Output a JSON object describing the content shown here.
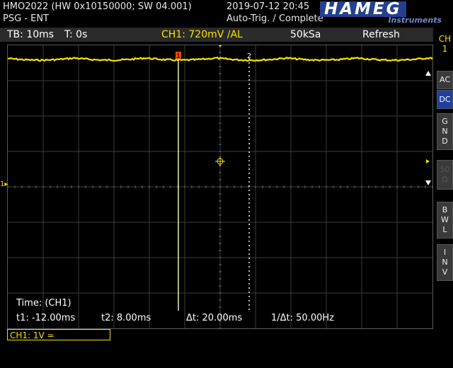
{
  "header": {
    "model": "HMO2022 (HW 0x10150000; SW 04.001)",
    "mode": "PSG - ENT",
    "datetime": "2019-07-12 20:45",
    "trigger_status": "Auto-Trig. / Complete",
    "brand": "HAMEG",
    "brand_sub": "Instruments"
  },
  "toolbar": {
    "timebase": "TB: 10ms",
    "trigger_time": "T: 0s",
    "ch1_trigger": "CH1: 720mV ∕AL",
    "sample_rate": "50kSa",
    "acq_mode": "Refresh"
  },
  "side_panel": {
    "channel": "CH\n1",
    "buttons": [
      {
        "label": "AC",
        "active": false
      },
      {
        "label": "DC",
        "active": true
      },
      {
        "label": "G\nN\nD",
        "active": false
      },
      {
        "label": "50\nΩ",
        "active": false
      },
      {
        "label": "B\nW\nL",
        "active": false
      },
      {
        "label": "I\nN\nV",
        "active": false
      }
    ]
  },
  "cursors": {
    "title": "Time: (CH1)",
    "t1": "t1: -12.00ms",
    "t2": "t2: 8.00ms",
    "dt": "Δt: 20.00ms",
    "inv_dt": "1/Δt: 50.00Hz",
    "marker1": "1",
    "marker2": "2"
  },
  "channel_box": "CH1: 1V ≃",
  "colors": {
    "trace": "#f5e400",
    "grid": "#3c3c3c",
    "accent": "#1f3fa0",
    "cursor1": "#fff8c0",
    "marker": "#e84a00"
  }
}
